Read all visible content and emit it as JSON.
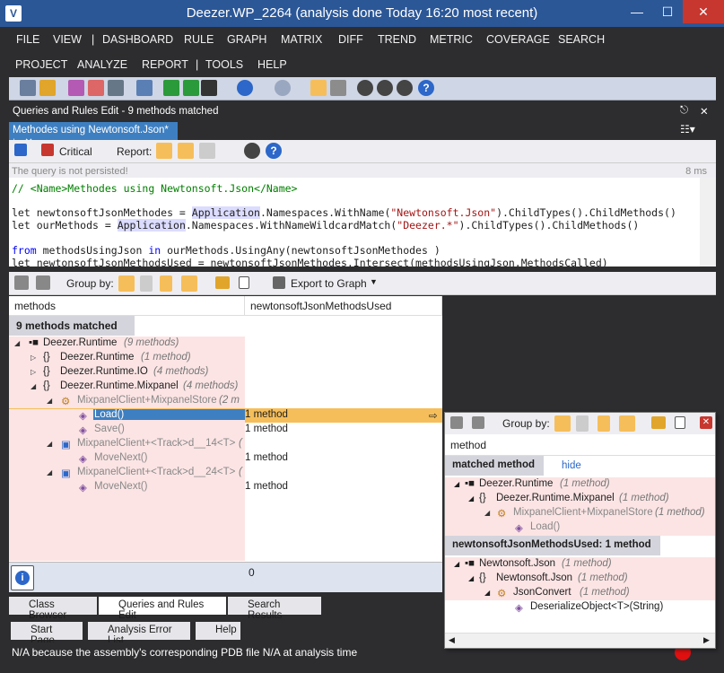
{
  "window": {
    "title": "Deezer.WP_2264  (analysis done Today 16:20 most recent)"
  },
  "menu": {
    "row1": [
      "FILE",
      "VIEW",
      "|",
      "DASHBOARD",
      "RULE",
      "GRAPH",
      "MATRIX",
      "DIFF",
      "TREND",
      "METRIC",
      "COVERAGE",
      "SEARCH"
    ],
    "row2": [
      "PROJECT",
      "ANALYZE",
      "REPORT",
      "|",
      "TOOLS",
      "HELP"
    ]
  },
  "queries_panel": {
    "title": "Queries and Rules Edit  - 9 methods matched",
    "tab_label": "Methodes using Newtonsoft.Json*",
    "critical_label": "Critical",
    "report_label": "Report:",
    "not_persisted": "The query is not persisted!",
    "elapsed": "8 ms"
  },
  "code": {
    "line1": "// <Name>Methodes using Newtonsoft.Json</Name>",
    "line3a": "let newtonsoftJsonMethodes = ",
    "line3b": "Application",
    "line3c": ".Namespaces.WithName(",
    "line3d": "\"Newtonsoft.Json\"",
    "line3e": ").ChildTypes().ChildMethods()",
    "line4a": "let ourMethods = ",
    "line4b": "Application",
    "line4c": ".Namespaces.WithNameWildcardMatch(",
    "line4d": "\"Deezer.*\"",
    "line4e": ").ChildTypes().ChildMethods()",
    "line6a": "from",
    "line6b": " methodsUsingJson ",
    "line6c": "in",
    "line6d": " ourMethods.UsingAny(newtonsoftJsonMethodes )",
    "line7": "let newtonsoftJsonMethodsUsed = newtonsoftJsonMethodes.Intersect(methodsUsingJson.MethodsCalled)"
  },
  "results_toolbar": {
    "group_by": "Group by:",
    "export": "Export to Graph"
  },
  "results": {
    "col1": "methods",
    "col2": "newtonsoftJsonMethodsUsed",
    "matched": "9 methods matched",
    "rows": [
      {
        "name": "Deezer.Runtime",
        "count": "(9 methods)",
        "value": ""
      },
      {
        "name": "Deezer.Runtime",
        "count": "(1 method)",
        "value": ""
      },
      {
        "name": "Deezer.Runtime.IO",
        "count": "(4 methods)",
        "value": ""
      },
      {
        "name": "Deezer.Runtime.Mixpanel",
        "count": "(4 methods)",
        "value": ""
      },
      {
        "name": "MixpanelClient+MixpanelStore",
        "count": "(2 m",
        "value": ""
      },
      {
        "name": "Load()",
        "count": "",
        "value": "1 method"
      },
      {
        "name": "Save()",
        "count": "",
        "value": "1 method"
      },
      {
        "name": "MixpanelClient+<Track>d__14<T>",
        "count": "(",
        "value": ""
      },
      {
        "name": "MoveNext()",
        "count": "",
        "value": "1 method"
      },
      {
        "name": "MixpanelClient+<Track>d__24<T>",
        "count": "(",
        "value": ""
      },
      {
        "name": "MoveNext()",
        "count": "",
        "value": "1 method"
      }
    ],
    "total": "0"
  },
  "bottom_tabs": [
    "Class Browser",
    "Queries and Rules Edit",
    "Search Results"
  ],
  "start_tabs": [
    "Start Page",
    "Analysis Error List",
    "Help"
  ],
  "status": "N/A because the assembly's corresponding PDB file N/A at analysis time",
  "popup": {
    "group_by": "Group by:",
    "column": "method",
    "matched_header": "matched method",
    "hide": "hide",
    "matched_rows": [
      {
        "name": "Deezer.Runtime",
        "count": "(1 method)"
      },
      {
        "name": "Deezer.Runtime.Mixpanel",
        "count": "(1 method)"
      },
      {
        "name": "MixpanelClient+MixpanelStore",
        "count": "(1 method)"
      },
      {
        "name": "Load()",
        "count": ""
      }
    ],
    "used_header": "newtonsoftJsonMethodsUsed:  1 method",
    "used_rows": [
      {
        "name": "Newtonsoft.Json",
        "count": "(1 method)"
      },
      {
        "name": "Newtonsoft.Json",
        "count": "(1 method)"
      },
      {
        "name": "JsonConvert",
        "count": "(1 method)"
      },
      {
        "name": "DeserializeObject<T>(String)",
        "count": ""
      }
    ]
  }
}
